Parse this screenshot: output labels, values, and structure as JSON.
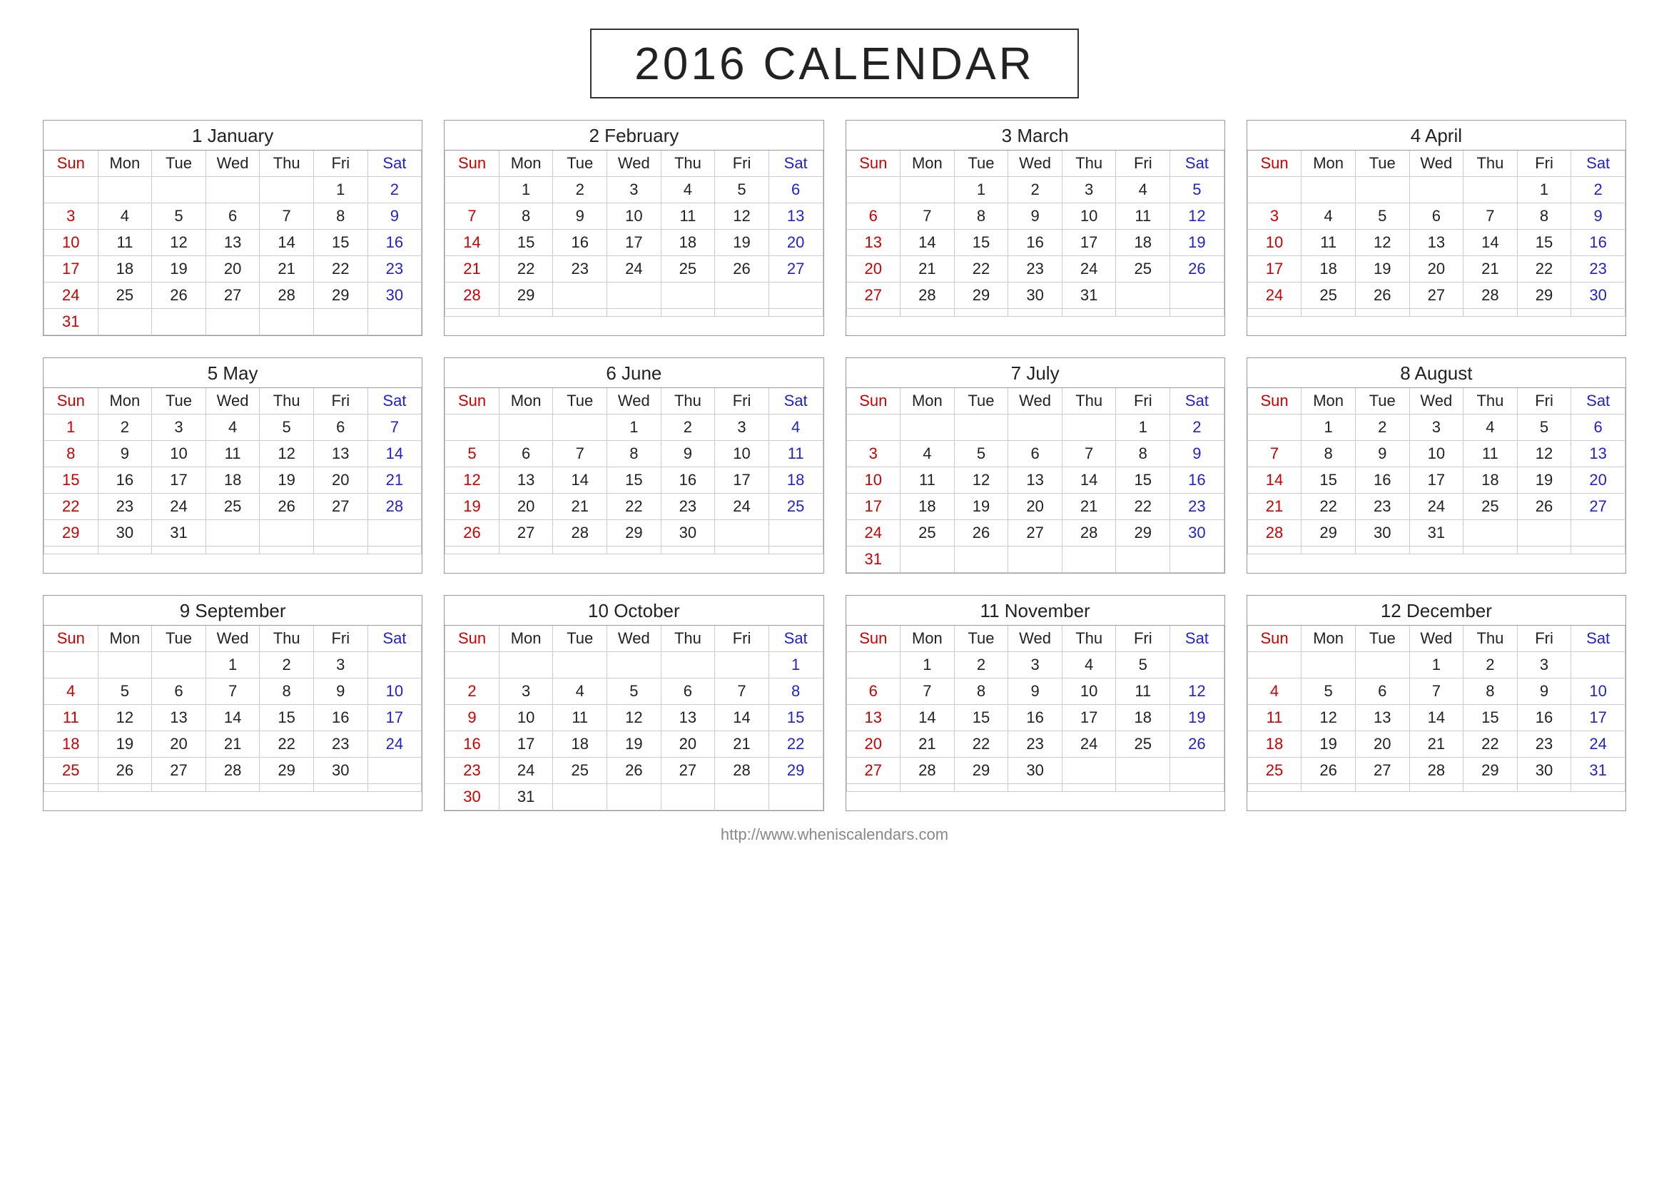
{
  "title": "2016 CALENDAR",
  "footer_url": "http://www.wheniscalendars.com",
  "months": [
    {
      "num": 1,
      "name": "January",
      "weeks": [
        [
          "",
          "",
          "",
          "",
          "",
          "1",
          "2"
        ],
        [
          "3",
          "4",
          "5",
          "6",
          "7",
          "8",
          "9"
        ],
        [
          "10",
          "11",
          "12",
          "13",
          "14",
          "15",
          "16"
        ],
        [
          "17",
          "18",
          "19",
          "20",
          "21",
          "22",
          "23"
        ],
        [
          "24",
          "25",
          "26",
          "27",
          "28",
          "29",
          "30"
        ],
        [
          "31",
          "",
          "",
          "",
          "",
          "",
          ""
        ]
      ]
    },
    {
      "num": 2,
      "name": "February",
      "weeks": [
        [
          "",
          "1",
          "2",
          "3",
          "4",
          "5",
          "6"
        ],
        [
          "7",
          "8",
          "9",
          "10",
          "11",
          "12",
          "13"
        ],
        [
          "14",
          "15",
          "16",
          "17",
          "18",
          "19",
          "20"
        ],
        [
          "21",
          "22",
          "23",
          "24",
          "25",
          "26",
          "27"
        ],
        [
          "28",
          "29",
          "",
          "",
          "",
          "",
          ""
        ],
        [
          "",
          "",
          "",
          "",
          "",
          "",
          ""
        ]
      ]
    },
    {
      "num": 3,
      "name": "March",
      "weeks": [
        [
          "",
          "",
          "1",
          "2",
          "3",
          "4",
          "5"
        ],
        [
          "6",
          "7",
          "8",
          "9",
          "10",
          "11",
          "12"
        ],
        [
          "13",
          "14",
          "15",
          "16",
          "17",
          "18",
          "19"
        ],
        [
          "20",
          "21",
          "22",
          "23",
          "24",
          "25",
          "26"
        ],
        [
          "27",
          "28",
          "29",
          "30",
          "31",
          "",
          ""
        ],
        [
          "",
          "",
          "",
          "",
          "",
          "",
          ""
        ]
      ]
    },
    {
      "num": 4,
      "name": "April",
      "weeks": [
        [
          "",
          "",
          "",
          "",
          "",
          "1",
          "2"
        ],
        [
          "3",
          "4",
          "5",
          "6",
          "7",
          "8",
          "9"
        ],
        [
          "10",
          "11",
          "12",
          "13",
          "14",
          "15",
          "16"
        ],
        [
          "17",
          "18",
          "19",
          "20",
          "21",
          "22",
          "23"
        ],
        [
          "24",
          "25",
          "26",
          "27",
          "28",
          "29",
          "30"
        ],
        [
          "",
          "",
          "",
          "",
          "",
          "",
          ""
        ]
      ]
    },
    {
      "num": 5,
      "name": "May",
      "weeks": [
        [
          "1",
          "2",
          "3",
          "4",
          "5",
          "6",
          "7"
        ],
        [
          "8",
          "9",
          "10",
          "11",
          "12",
          "13",
          "14"
        ],
        [
          "15",
          "16",
          "17",
          "18",
          "19",
          "20",
          "21"
        ],
        [
          "22",
          "23",
          "24",
          "25",
          "26",
          "27",
          "28"
        ],
        [
          "29",
          "30",
          "31",
          "",
          "",
          "",
          ""
        ],
        [
          "",
          "",
          "",
          "",
          "",
          "",
          ""
        ]
      ]
    },
    {
      "num": 6,
      "name": "June",
      "weeks": [
        [
          "",
          "",
          "",
          "1",
          "2",
          "3",
          "4"
        ],
        [
          "5",
          "6",
          "7",
          "8",
          "9",
          "10",
          "11"
        ],
        [
          "12",
          "13",
          "14",
          "15",
          "16",
          "17",
          "18"
        ],
        [
          "19",
          "20",
          "21",
          "22",
          "23",
          "24",
          "25"
        ],
        [
          "26",
          "27",
          "28",
          "29",
          "30",
          "",
          ""
        ],
        [
          "",
          "",
          "",
          "",
          "",
          "",
          ""
        ]
      ]
    },
    {
      "num": 7,
      "name": "July",
      "weeks": [
        [
          "",
          "",
          "",
          "",
          "",
          "1",
          "2"
        ],
        [
          "3",
          "4",
          "5",
          "6",
          "7",
          "8",
          "9"
        ],
        [
          "10",
          "11",
          "12",
          "13",
          "14",
          "15",
          "16"
        ],
        [
          "17",
          "18",
          "19",
          "20",
          "21",
          "22",
          "23"
        ],
        [
          "24",
          "25",
          "26",
          "27",
          "28",
          "29",
          "30"
        ],
        [
          "31",
          "",
          "",
          "",
          "",
          "",
          ""
        ]
      ]
    },
    {
      "num": 8,
      "name": "August",
      "weeks": [
        [
          "",
          "1",
          "2",
          "3",
          "4",
          "5",
          "6"
        ],
        [
          "7",
          "8",
          "9",
          "10",
          "11",
          "12",
          "13"
        ],
        [
          "14",
          "15",
          "16",
          "17",
          "18",
          "19",
          "20"
        ],
        [
          "21",
          "22",
          "23",
          "24",
          "25",
          "26",
          "27"
        ],
        [
          "28",
          "29",
          "30",
          "31",
          "",
          "",
          ""
        ],
        [
          "",
          "",
          "",
          "",
          "",
          "",
          ""
        ]
      ]
    },
    {
      "num": 9,
      "name": "September",
      "weeks": [
        [
          "",
          "",
          "",
          "1",
          "2",
          "3",
          ""
        ],
        [
          "4",
          "5",
          "6",
          "7",
          "8",
          "9",
          "10"
        ],
        [
          "11",
          "12",
          "13",
          "14",
          "15",
          "16",
          "17"
        ],
        [
          "18",
          "19",
          "20",
          "21",
          "22",
          "23",
          "24"
        ],
        [
          "25",
          "26",
          "27",
          "28",
          "29",
          "30",
          ""
        ],
        [
          "",
          "",
          "",
          "",
          "",
          "",
          ""
        ]
      ]
    },
    {
      "num": 10,
      "name": "October",
      "weeks": [
        [
          "",
          "",
          "",
          "",
          "",
          "",
          "1"
        ],
        [
          "2",
          "3",
          "4",
          "5",
          "6",
          "7",
          "8"
        ],
        [
          "9",
          "10",
          "11",
          "12",
          "13",
          "14",
          "15"
        ],
        [
          "16",
          "17",
          "18",
          "19",
          "20",
          "21",
          "22"
        ],
        [
          "23",
          "24",
          "25",
          "26",
          "27",
          "28",
          "29"
        ],
        [
          "30",
          "31",
          "",
          "",
          "",
          "",
          ""
        ]
      ]
    },
    {
      "num": 11,
      "name": "November",
      "weeks": [
        [
          "",
          "1",
          "2",
          "3",
          "4",
          "5",
          ""
        ],
        [
          "6",
          "7",
          "8",
          "9",
          "10",
          "11",
          "12"
        ],
        [
          "13",
          "14",
          "15",
          "16",
          "17",
          "18",
          "19"
        ],
        [
          "20",
          "21",
          "22",
          "23",
          "24",
          "25",
          "26"
        ],
        [
          "27",
          "28",
          "29",
          "30",
          "",
          "",
          ""
        ],
        [
          "",
          "",
          "",
          "",
          "",
          "",
          ""
        ]
      ]
    },
    {
      "num": 12,
      "name": "December",
      "weeks": [
        [
          "",
          "",
          "",
          "1",
          "2",
          "3",
          ""
        ],
        [
          "4",
          "5",
          "6",
          "7",
          "8",
          "9",
          "10"
        ],
        [
          "11",
          "12",
          "13",
          "14",
          "15",
          "16",
          "17"
        ],
        [
          "18",
          "19",
          "20",
          "21",
          "22",
          "23",
          "24"
        ],
        [
          "25",
          "26",
          "27",
          "28",
          "29",
          "30",
          "31"
        ],
        [
          "",
          "",
          "",
          "",
          "",
          "",
          ""
        ]
      ]
    }
  ],
  "day_headers": [
    "Sun",
    "Mon",
    "Tue",
    "Wed",
    "Thu",
    "Fri",
    "Sat"
  ]
}
